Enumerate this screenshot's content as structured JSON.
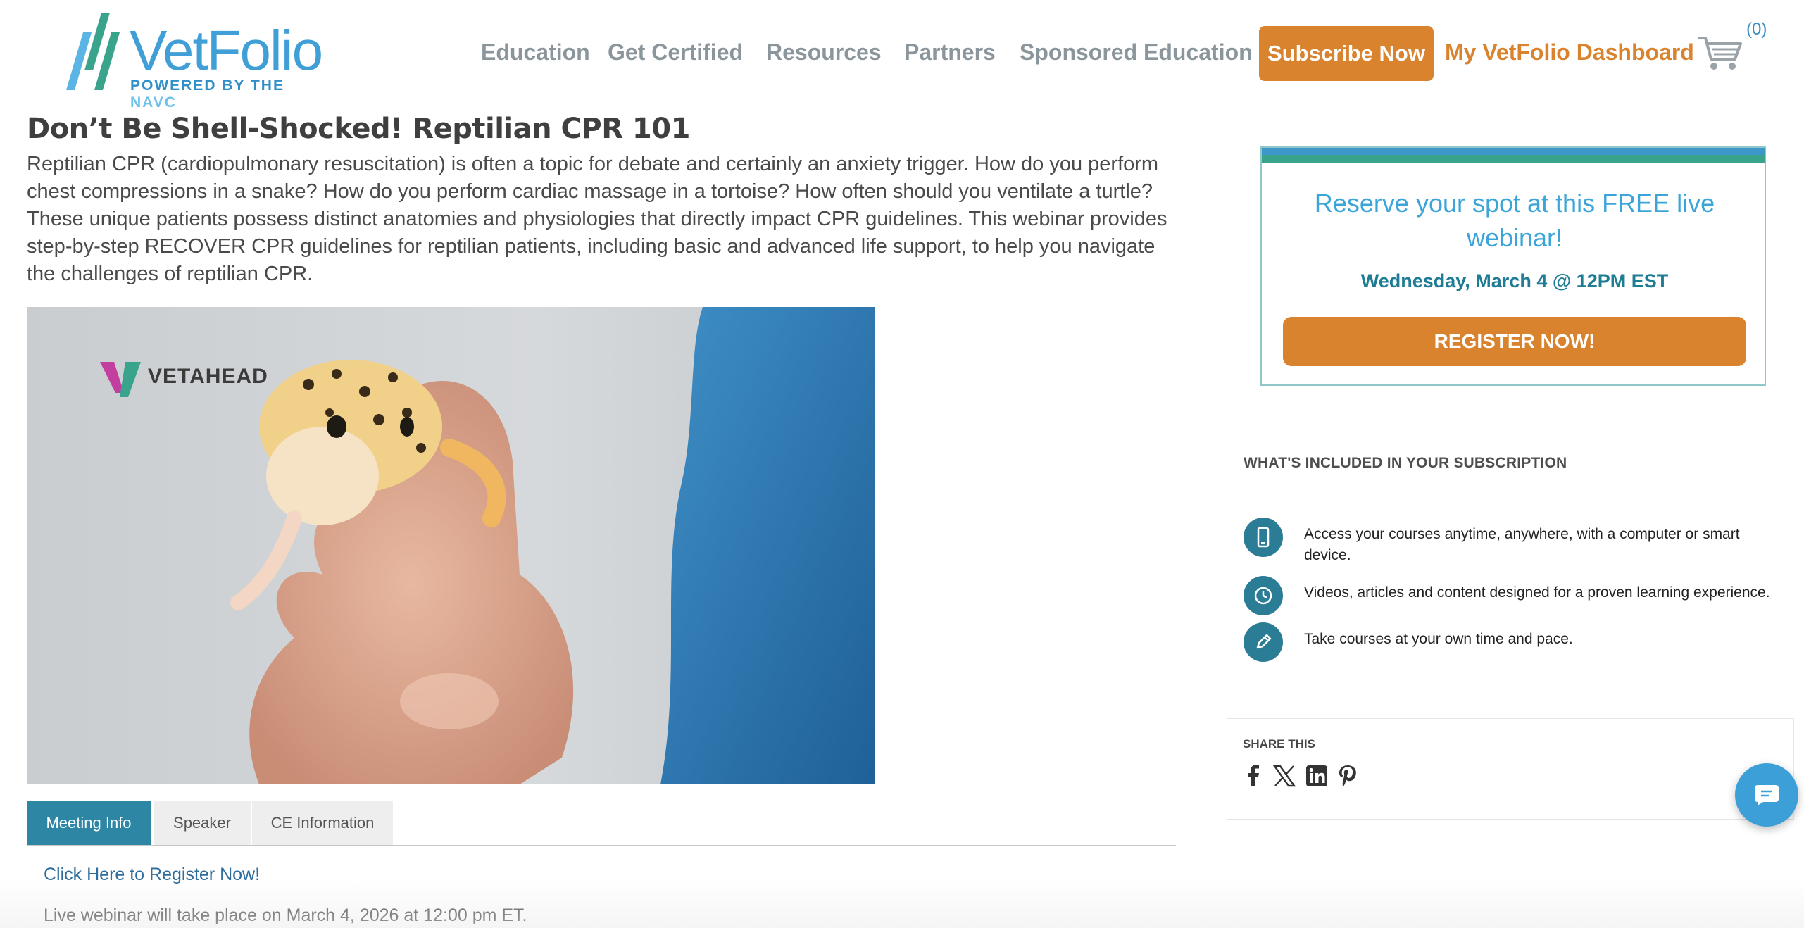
{
  "header": {
    "logo": {
      "word": "VetFolio",
      "sub_prefix": "POWERED BY THE ",
      "sub_brand": "NAVC"
    },
    "nav": [
      "Education",
      "Get Certified",
      "Resources",
      "Partners",
      "Sponsored Education"
    ],
    "subscribe_label": "Subscribe Now",
    "dashboard_label": "My VetFolio Dashboard",
    "cart_count": "(0)",
    "icons": {
      "cart": "shopping-cart-icon"
    }
  },
  "main": {
    "title": "Don’t Be Shell-Shocked! Reptilian CPR 101",
    "intro": "Reptilian CPR (cardiopulmonary resuscitation) is often a topic for debate and certainly an anxiety trigger. How do you perform chest compressions in a snake? How do you perform cardiac massage in a tortoise? How often should you ventilate a turtle? These unique patients possess distinct anatomies and physiologies that directly impact CPR guidelines. This webinar provides step-by-step RECOVER CPR guidelines for reptilian patients, including basic and advanced life support, to help you navigate the challenges of reptilian CPR.",
    "hero_logo_text": "VETAHEAD",
    "tabs": [
      {
        "label": "Meeting Info",
        "active": true
      },
      {
        "label": "Speaker",
        "active": false
      },
      {
        "label": "CE Information",
        "active": false
      }
    ],
    "register_link": "Click Here to Register Now!",
    "live_note": "Live webinar will take place on March 4, 2026 at 12:00 pm ET."
  },
  "sidebar": {
    "reserve": {
      "title": "Reserve your spot at this FREE live webinar!",
      "date": "Wednesday, March 4 @ 12PM EST",
      "button": "REGISTER NOW!"
    },
    "included": {
      "heading": "WHAT'S INCLUDED IN YOUR SUBSCRIPTION",
      "items": [
        {
          "icon": "mobile-device-icon",
          "text": "Access your courses anytime, anywhere, with a computer or smart device."
        },
        {
          "icon": "clock-icon",
          "text": "Videos, articles and content designed for a proven learning experience."
        },
        {
          "icon": "pencil-icon",
          "text": "Take courses at your own time and pace."
        }
      ]
    },
    "share": {
      "heading": "SHARE THIS",
      "icons": [
        "facebook-icon",
        "x-icon",
        "linkedin-icon",
        "pinterest-icon"
      ]
    }
  },
  "colors": {
    "accent_orange": "#d9832e",
    "teal": "#2e86a5",
    "link_blue": "#3ba4d8"
  }
}
